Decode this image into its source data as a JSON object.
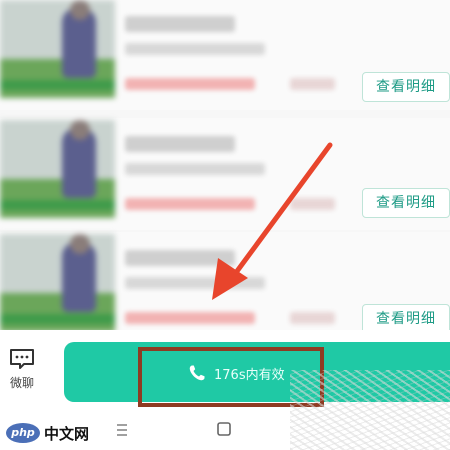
{
  "list": {
    "detail_label": "查看明细"
  },
  "action_bar": {
    "chat_label": "微聊",
    "call_label": "176s内有效"
  },
  "watermark": {
    "logo": "php",
    "text": "中文网"
  },
  "colors": {
    "accent": "#1fc9a5",
    "detail_text": "#1e9b86",
    "highlight_border": "#8e3b22",
    "arrow": "#e8452c"
  },
  "icons": {
    "chat": "chat-bubble-icon",
    "phone": "phone-icon",
    "menu": "menu-icon",
    "home": "home-square-icon"
  }
}
